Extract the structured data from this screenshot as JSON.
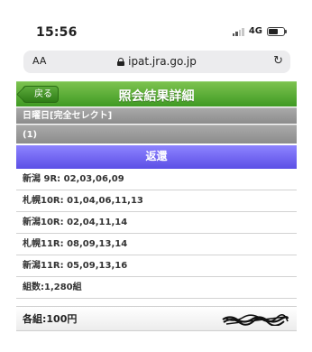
{
  "status_bar": {
    "time": "15:56",
    "network": "4G"
  },
  "browser": {
    "text_size_label": "AA",
    "url": "ipat.jra.go.jp",
    "reload_icon": "reload-icon"
  },
  "header": {
    "back_label": "戻る",
    "title": "照会結果詳細"
  },
  "info": {
    "bet_type": "日曜日[完全セレクト]",
    "number": "(1)"
  },
  "refund": {
    "label": "返還"
  },
  "rows": [
    "新潟  9R: 02,03,06,09",
    "札幌10R: 01,04,06,11,13",
    "新潟10R: 02,04,11,14",
    "札幌11R: 08,09,13,14",
    "新潟11R: 05,09,13,16",
    "組数:1,280組"
  ],
  "footer": {
    "per_combo": "各組:100円"
  },
  "colors": {
    "header_green": "#3f9a23",
    "refund_blue": "#5b4fe6",
    "gray_bar": "#8c8c8c"
  }
}
